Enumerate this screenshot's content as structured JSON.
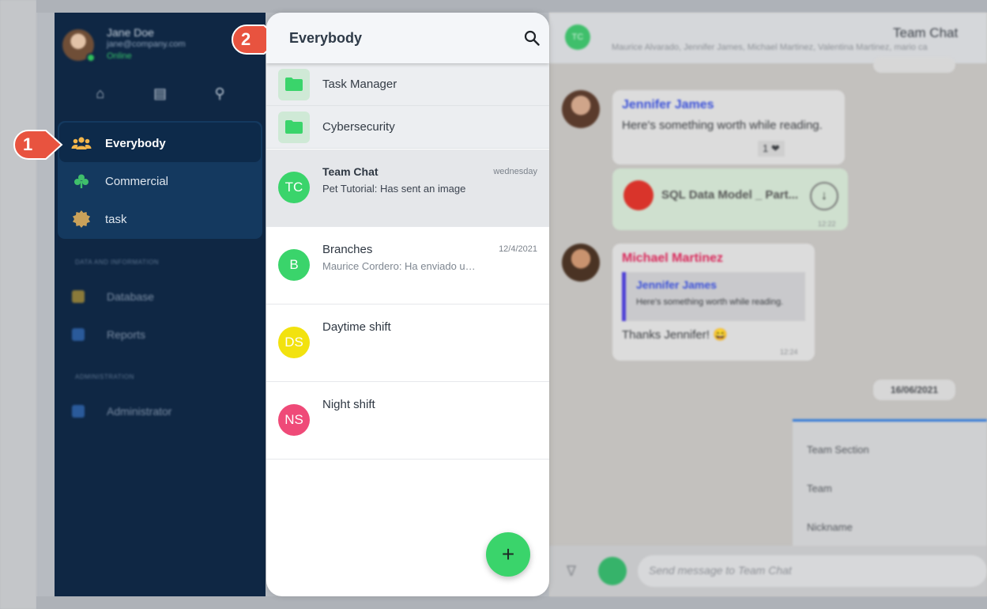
{
  "profile": {
    "name": "Jane Doe",
    "email": "jane@company.com",
    "status": "Online"
  },
  "sidebar": {
    "nav": [
      {
        "label": "Everybody",
        "icon": "users-icon",
        "color": "#f2b54a"
      },
      {
        "label": "Commercial",
        "icon": "club-icon",
        "color": "#3fbf6b"
      },
      {
        "label": "task",
        "icon": "badge-icon",
        "color": "#c9a15a"
      }
    ],
    "section_data": "DATA AND INFORMATION",
    "data_items": [
      {
        "label": "Database",
        "icon": "database-icon"
      },
      {
        "label": "Reports",
        "icon": "reports-icon"
      }
    ],
    "section_admin": "ADMINISTRATION",
    "admin_items": [
      {
        "label": "Administrator",
        "icon": "admin-icon"
      }
    ]
  },
  "modal": {
    "title": "Everybody",
    "folders": [
      {
        "label": "Task Manager"
      },
      {
        "label": "Cybersecurity"
      }
    ],
    "chats": [
      {
        "initials": "TC",
        "name": "Team Chat",
        "preview": "Pet Tutorial: Has sent an image",
        "date": "wednesday",
        "color": "#3ad46b",
        "selected": true
      },
      {
        "initials": "B",
        "name": "Branches",
        "preview": "Maurice Cordero: Ha enviado un ...",
        "date": "12/4/2021",
        "color": "#3ad46b",
        "selected": false
      },
      {
        "initials": "DS",
        "name": "Daytime shift",
        "preview": "",
        "date": "",
        "color": "#f2e20f",
        "selected": false
      },
      {
        "initials": "NS",
        "name": "Night shift",
        "preview": "",
        "date": "",
        "color": "#ef4a78",
        "selected": false
      }
    ],
    "fab_label": "+"
  },
  "chat": {
    "initials": "TC",
    "title": "Team Chat",
    "members": "Maurice Alvarado, Jennifer James, Michael Martinez, Valentina Martinez, mario ca",
    "messages": {
      "m1_name": "Jennifer James",
      "m1_text": "Here's something worth while reading.",
      "m1_reaction": "1 ❤",
      "m1_file": "SQL Data Model _ Part...",
      "m1_time": "12:22",
      "m2_name": "Michael Martinez",
      "m2_quote_name": "Jennifer James",
      "m2_quote_text": "Here's something worth while reading.",
      "m2_text": "Thanks Jennifer! 😄",
      "m2_time": "12:24"
    },
    "date_pill": "16/06/2021",
    "form_rows": [
      "Team Section",
      "Team",
      "Nickname"
    ],
    "composer_placeholder": "Send message to Team Chat"
  },
  "callouts": [
    "1",
    "2"
  ],
  "colors": {
    "accent_green": "#3ad46b",
    "callout_red": "#e8533f",
    "sidebar_bg": "#0f2744"
  }
}
